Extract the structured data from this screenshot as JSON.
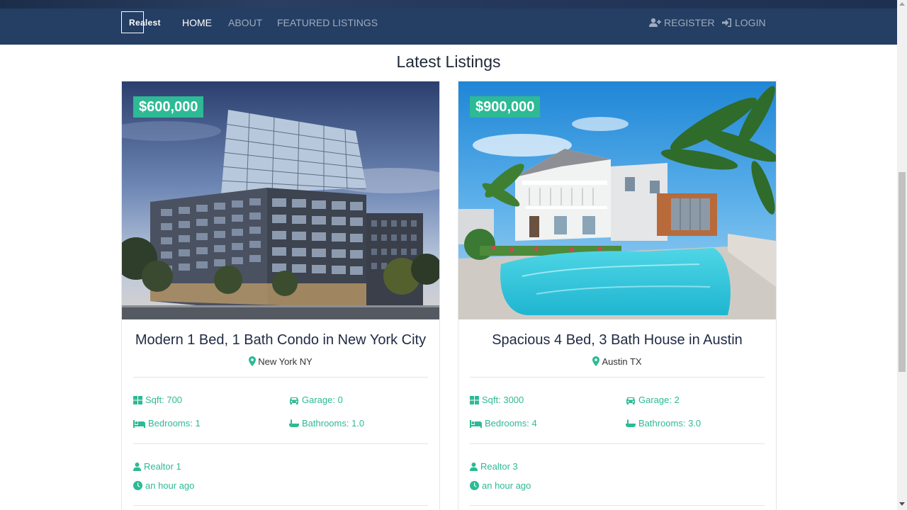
{
  "nav": {
    "brand": "Realest",
    "links": [
      {
        "label": "HOME",
        "active": true
      },
      {
        "label": "ABOUT",
        "active": false
      },
      {
        "label": "FEATURED LISTINGS",
        "active": false
      }
    ],
    "register": "REGISTER",
    "login": "LOGIN"
  },
  "section_title": "Latest Listings",
  "listings": [
    {
      "price": "$600,000",
      "title": "Modern 1 Bed, 1 Bath Condo in New York City",
      "location": "New York NY",
      "sqft": "Sqft: 700",
      "garage": "Garage: 0",
      "bedrooms": "Bedrooms: 1",
      "bathrooms": "Bathrooms: 1.0",
      "realtor": "Realtor 1",
      "listed": "an hour ago"
    },
    {
      "price": "$900,000",
      "title": "Spacious 4 Bed, 3 Bath House in Austin",
      "location": "Austin TX",
      "sqft": "Sqft: 3000",
      "garage": "Garage: 2",
      "bedrooms": "Bedrooms: 4",
      "bathrooms": "Bathrooms: 3.0",
      "realtor": "Realtor 3",
      "listed": "an hour ago"
    }
  ],
  "colors": {
    "navbar": "#253e63",
    "accent": "#2dba94",
    "title": "#1f2a44"
  }
}
